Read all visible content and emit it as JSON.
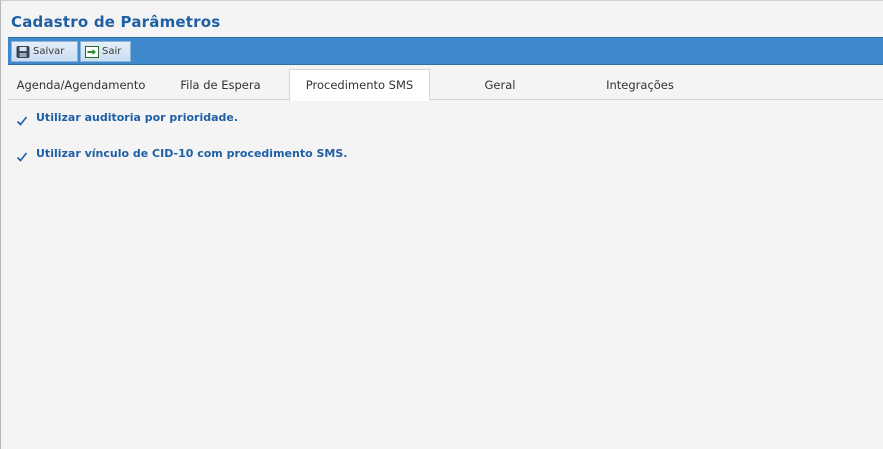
{
  "page": {
    "title": "Cadastro de Parâmetros"
  },
  "toolbar": {
    "save_label": "Salvar",
    "exit_label": "Sair"
  },
  "tabs": [
    {
      "label": "Agenda/Agendamento",
      "active": false
    },
    {
      "label": "Fila de Espera",
      "active": false
    },
    {
      "label": "Procedimento SMS",
      "active": true
    },
    {
      "label": "Geral",
      "active": false
    },
    {
      "label": "Integrações",
      "active": false
    }
  ],
  "options": [
    {
      "label": "Utilizar auditoria por prioridade.",
      "checked": true
    },
    {
      "label": "Utilizar vínculo de CID-10 com procedimento SMS.",
      "checked": true
    }
  ],
  "colors": {
    "accent": "#1f5fa6",
    "toolbar": "#3f88cc",
    "background": "#f4f4f4"
  },
  "icons": {
    "save": "floppy-disk-icon",
    "exit": "exit-arrow-icon",
    "check": "checkmark-icon"
  }
}
